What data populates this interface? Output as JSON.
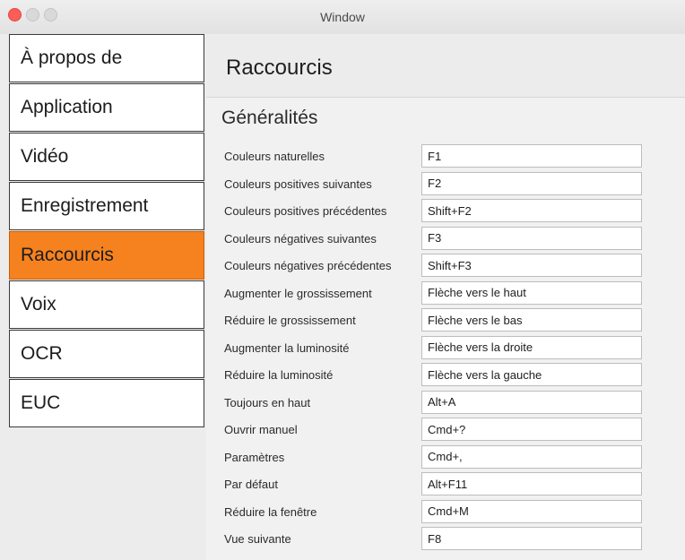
{
  "window": {
    "title": "Window"
  },
  "sidebar": {
    "items": [
      {
        "label": "À propos de"
      },
      {
        "label": "Application"
      },
      {
        "label": "Vidéo"
      },
      {
        "label": "Enregistrement"
      },
      {
        "label": "Raccourcis",
        "active": true
      },
      {
        "label": "Voix"
      },
      {
        "label": "OCR"
      },
      {
        "label": "EUC"
      }
    ],
    "active_color": "#f5821f"
  },
  "main": {
    "title": "Raccourcis",
    "section": "Généralités",
    "shortcuts": [
      {
        "label": "Couleurs naturelles",
        "value": "F1"
      },
      {
        "label": "Couleurs positives suivantes",
        "value": "F2"
      },
      {
        "label": "Couleurs positives précédentes",
        "value": "Shift+F2"
      },
      {
        "label": "Couleurs négatives suivantes",
        "value": "F3"
      },
      {
        "label": "Couleurs négatives précédentes",
        "value": "Shift+F3"
      },
      {
        "label": "Augmenter le grossissement",
        "value": "Flèche vers le haut"
      },
      {
        "label": "Réduire le grossissement",
        "value": "Flèche vers le bas"
      },
      {
        "label": "Augmenter la luminosité",
        "value": "Flèche vers la droite"
      },
      {
        "label": "Réduire la luminosité",
        "value": "Flèche vers la gauche"
      },
      {
        "label": "Toujours en haut",
        "value": "Alt+A"
      },
      {
        "label": "Ouvrir manuel",
        "value": "Cmd+?"
      },
      {
        "label": "Paramètres",
        "value": "Cmd+,"
      },
      {
        "label": "Par défaut",
        "value": "Alt+F11"
      },
      {
        "label": "Réduire la fenêtre",
        "value": "Cmd+M"
      },
      {
        "label": "Vue suivante",
        "value": "F8"
      }
    ]
  }
}
